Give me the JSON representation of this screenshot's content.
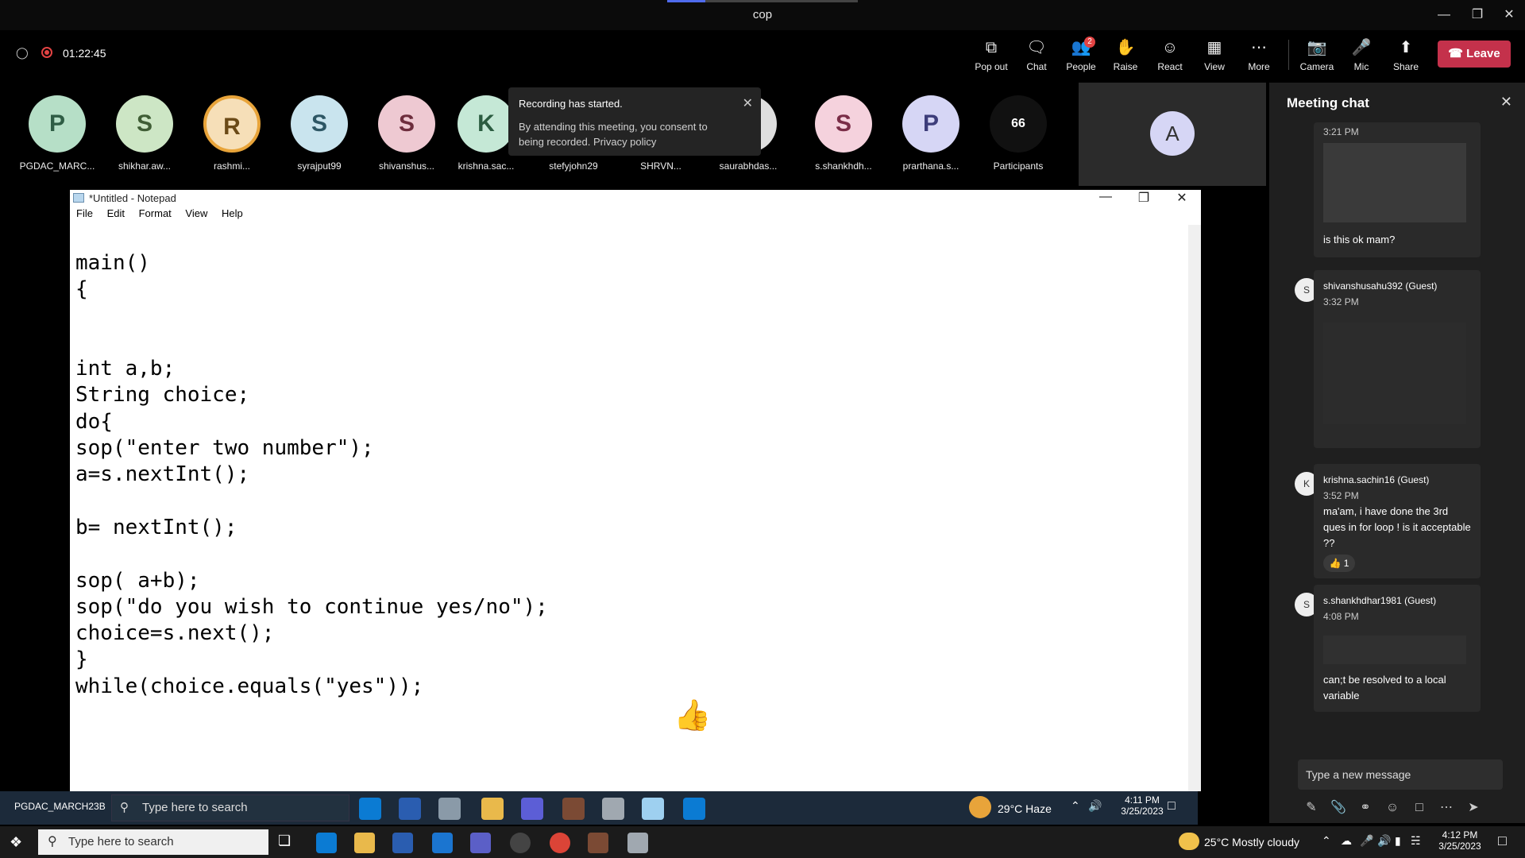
{
  "window": {
    "title": "cop"
  },
  "meeting": {
    "timer": "01:22:45",
    "toolbar": [
      {
        "name": "pop-out",
        "label": "Pop out",
        "icon": "popout-icon"
      },
      {
        "name": "chat",
        "label": "Chat",
        "icon": "chat-icon"
      },
      {
        "name": "people",
        "label": "People",
        "icon": "people-icon",
        "badge": "2"
      },
      {
        "name": "raise",
        "label": "Raise",
        "icon": "hand-icon"
      },
      {
        "name": "react",
        "label": "React",
        "icon": "smiley-icon"
      },
      {
        "name": "view",
        "label": "View",
        "icon": "grid-icon"
      },
      {
        "name": "more",
        "label": "More",
        "icon": "ellipsis-icon"
      },
      {
        "name": "camera",
        "label": "Camera",
        "icon": "camera-off-icon"
      },
      {
        "name": "mic",
        "label": "Mic",
        "icon": "mic-off-icon"
      },
      {
        "name": "share",
        "label": "Share",
        "icon": "share-icon"
      }
    ],
    "leave_label": "Leave"
  },
  "participants": [
    {
      "initial": "P",
      "name": "PGDAC_MARC...",
      "color": "#b6dfc7"
    },
    {
      "initial": "S",
      "name": "shikhar.aw...",
      "color": "#cde6c5"
    },
    {
      "initial": "R",
      "name": "rashmi...",
      "color": "#f6dfb8"
    },
    {
      "initial": "S",
      "name": "syrajput99",
      "color": "#c9e4ee"
    },
    {
      "initial": "S",
      "name": "shivanshus...",
      "color": "#eec9d2"
    },
    {
      "initial": "K",
      "name": "krishna.sac...",
      "color": "#c5e8d6"
    },
    {
      "initial": "",
      "name": "stefyjohn29",
      "color": "#000000"
    },
    {
      "initial": "",
      "name": "SHRVN...",
      "color": "#000000"
    },
    {
      "initial": "",
      "name": "saurabhdas...",
      "color": "#dedede"
    },
    {
      "initial": "S",
      "name": "s.shankhdh...",
      "color": "#f5d2dd"
    },
    {
      "initial": "P",
      "name": "prarthana.s...",
      "color": "#d6d6f5"
    },
    {
      "initial": "66",
      "name": "Participants",
      "color": "#111111"
    }
  ],
  "self_tile": {
    "initial": "A"
  },
  "toast": {
    "title": "Recording has started.",
    "body": "By attending this meeting, you consent to being recorded. Privacy policy"
  },
  "notepad": {
    "title": "*Untitled - Notepad",
    "menu": [
      "File",
      "Edit",
      "Format",
      "View",
      "Help"
    ],
    "content": "main()\n{\n\n\nint a,b;\nString choice;\ndo{\nsop(\"enter two number\");\na=s.nextInt();\n\nb= nextInt();\n\nsop( a+b);\nsop(\"do you wish to continue yes/no\");\nchoice=s.next();\n}\nwhile(choice.equals(\"yes\"));"
  },
  "chat": {
    "title": "Meeting chat",
    "messages": [
      {
        "author": "",
        "time": "3:21 PM",
        "text": "is this ok mam?"
      },
      {
        "author": "shivanshusahu392 (Guest)",
        "time": "3:32 PM",
        "text": ""
      },
      {
        "author": "krishna.sachin16 (Guest)",
        "time": "3:52 PM",
        "text": "ma'am, i have done the 3rd ques in for loop ! is it acceptable ??",
        "reaction": "1"
      },
      {
        "author": "s.shankhdhar1981 (Guest)",
        "time": "4:08 PM",
        "text": "can;t be resolved to a local variable"
      }
    ],
    "input_placeholder": "Type a new message"
  },
  "remote_taskbar": {
    "user": "PGDAC_MARCH23B",
    "search": "Type here to search",
    "weather": "29°C  Haze",
    "time": "4:11 PM",
    "date": "3/25/2023"
  },
  "taskbar": {
    "search": "Type here to search",
    "weather": "25°C  Mostly cloudy",
    "time": "4:12 PM",
    "date": "3/25/2023"
  }
}
